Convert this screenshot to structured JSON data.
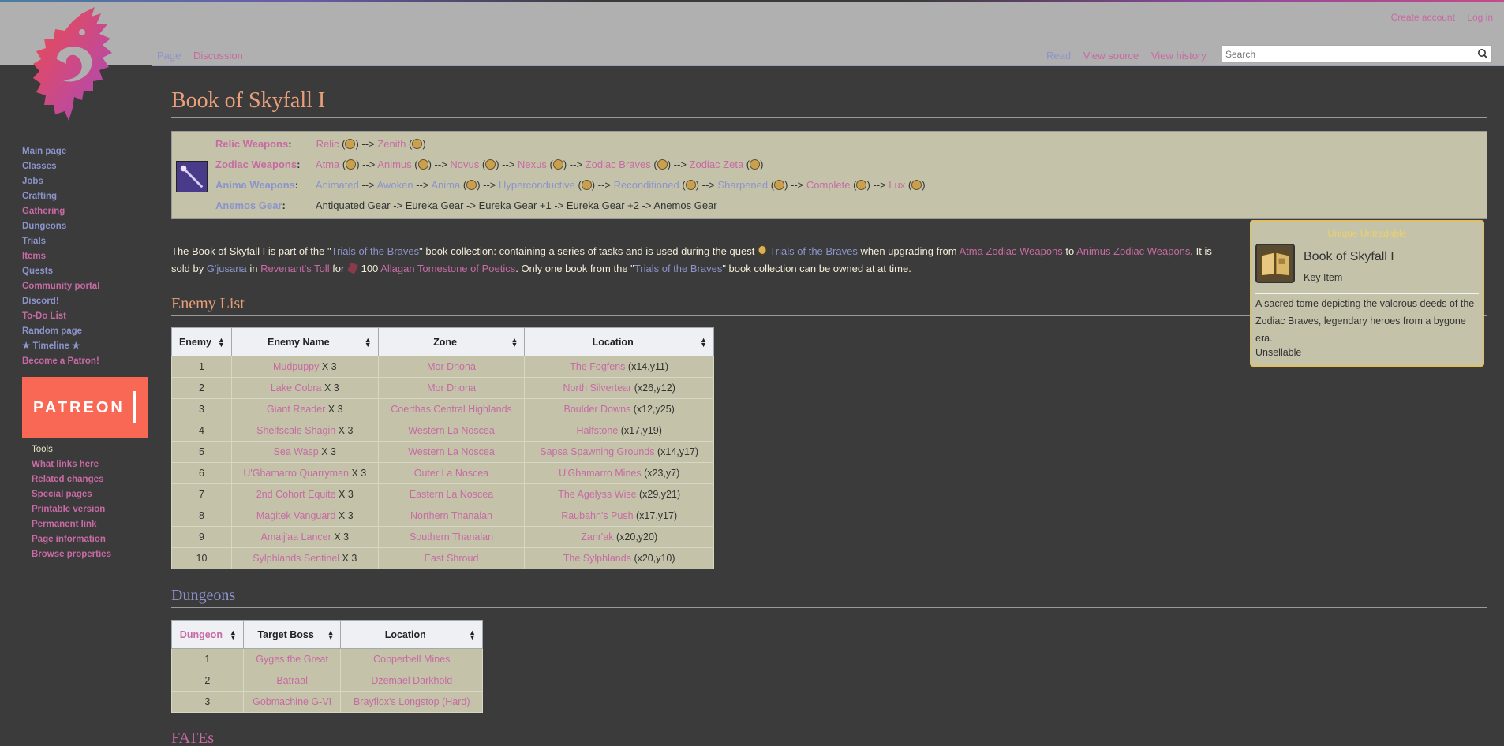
{
  "colors": {
    "link_pink": "#c86aa4",
    "link_blue": "#8c94cc",
    "header_bg": "#b0b0b0",
    "content_bg": "#3b3b3b",
    "box_bg": "#c4c3aa",
    "title_color": "#e8a07a",
    "patreon": "#f96854"
  },
  "header": {
    "personal": [
      "Create account",
      "Log in"
    ],
    "tabs_left": [
      "Page",
      "Discussion"
    ],
    "tabs_right": [
      "Read",
      "View source",
      "View history"
    ],
    "search_placeholder": "Search"
  },
  "sidebar": {
    "nav": [
      "Main page",
      "Classes",
      "Jobs",
      "Crafting",
      "Gathering",
      "Dungeons",
      "Trials",
      "Items",
      "Quests",
      "Community portal",
      "Discord!",
      "To-Do List",
      "Random page",
      "★ Timeline ★",
      "Become a Patron!"
    ],
    "patreon_label": "PATREON",
    "tools_heading": "Tools",
    "tools": [
      "What links here",
      "Related changes",
      "Special pages",
      "Printable version",
      "Permanent link",
      "Page information",
      "Browse properties"
    ]
  },
  "page_title": "Book of Skyfall I",
  "relic": {
    "row1_label": "Relic Weapons",
    "row1_items": [
      "Relic",
      "Zenith"
    ],
    "row2_label": "Zodiac Weapons",
    "row2_items": [
      "Atma",
      "Animus",
      "Novus",
      "Nexus",
      "Zodiac Braves",
      "Zodiac Zeta"
    ],
    "row3_label": "Anima Weapons",
    "row3_items": [
      "Animated",
      "Awoken",
      "Anima",
      "Hyperconductive",
      "Reconditioned",
      "Sharpened",
      "Complete",
      "Lux"
    ],
    "row4_label": "Anemos Gear",
    "row4_text": "Antiquated Gear -> Eureka Gear -> Eureka Gear +1 -> Eureka Gear +2 -> Anemos Gear"
  },
  "intro": {
    "t1": "The Book of Skyfall I is part of the \"",
    "l1": "Trials of the Braves",
    "t2": "\" book collection: containing a series of tasks and is used during the quest ",
    "l2": "Trials of the Braves",
    "t3": " when upgrading from ",
    "l3": "Atma Zodiac Weapons",
    "t4": " to ",
    "l4": "Animus Zodiac Weapons",
    "t5": ". It is sold by ",
    "l5": "G'jusana",
    "t6": " in ",
    "l6": "Revenant's Toll",
    "t7": " for ",
    "t8": " 100 ",
    "l7": "Allagan Tomestone of Poetics",
    "t9": ". Only one book from the \"",
    "l8": "Trials of the Braves",
    "t10": "\" book collection can be owned at at time."
  },
  "enemy_section": {
    "heading": "Enemy List",
    "headers": [
      "Enemy",
      "Enemy Name",
      "Zone",
      "Location"
    ],
    "rows": [
      {
        "n": "1",
        "name": "Mudpuppy",
        "count": " X 3",
        "zone": "Mor Dhona",
        "loc": "The Fogfens",
        "coords": " (x14,y11)"
      },
      {
        "n": "2",
        "name": "Lake Cobra",
        "count": " X 3",
        "zone": "Mor Dhona",
        "loc": "North Silvertear",
        "coords": " (x26,y12)"
      },
      {
        "n": "3",
        "name": "Giant Reader",
        "count": " X 3",
        "zone": "Coerthas Central Highlands",
        "loc": "Boulder Downs",
        "coords": " (x12,y25)"
      },
      {
        "n": "4",
        "name": "Shelfscale Shagin",
        "count": " X 3",
        "zone": "Western La Noscea",
        "loc": "Halfstone",
        "coords": " (x17,y19)"
      },
      {
        "n": "5",
        "name": "Sea Wasp",
        "count": " X 3",
        "zone": "Western La Noscea",
        "loc": "Sapsa Spawning Grounds",
        "coords": " (x14,y17)"
      },
      {
        "n": "6",
        "name": "U'Ghamarro Quarryman",
        "count": " X 3",
        "zone": "Outer La Noscea",
        "loc": "U'Ghamarro Mines",
        "coords": " (x23,y7)"
      },
      {
        "n": "7",
        "name": "2nd Cohort Equite",
        "count": " X 3",
        "zone": "Eastern La Noscea",
        "loc": "The Agelyss Wise",
        "coords": " (x29,y21)"
      },
      {
        "n": "8",
        "name": "Magitek Vanguard",
        "count": " X 3",
        "zone": "Northern Thanalan",
        "loc": "Raubahn's Push",
        "coords": " (x17,y17)"
      },
      {
        "n": "9",
        "name": "Amalj'aa Lancer",
        "count": " X 3",
        "zone": "Southern Thanalan",
        "loc": "Zanr'ak",
        "coords": " (x20,y20)"
      },
      {
        "n": "10",
        "name": "Sylphlands Sentinel",
        "count": " X 3",
        "zone": "East Shroud",
        "loc": "The Sylphlands",
        "coords": " (x20,y10)"
      }
    ]
  },
  "dungeon_section": {
    "heading": "Dungeons",
    "headers": [
      "Dungeon",
      "Target Boss",
      "Location"
    ],
    "rows": [
      {
        "n": "1",
        "boss": "Gyges the Great",
        "loc": "Copperbell Mines"
      },
      {
        "n": "2",
        "boss": "Batraal",
        "loc": "Dzemael Darkhold"
      },
      {
        "n": "3",
        "boss": "Gobmachine G-VI",
        "loc": "Brayflox's Longstop (Hard)"
      }
    ]
  },
  "fates_heading": "FATEs",
  "tooltip": {
    "flag": "Unique Untradable",
    "name": "Book of Skyfall I",
    "type": "Key Item",
    "desc": "A sacred tome depicting the valorous deeds of the Zodiac Braves, legendary heroes from a bygone era.",
    "sell": "Unsellable"
  }
}
